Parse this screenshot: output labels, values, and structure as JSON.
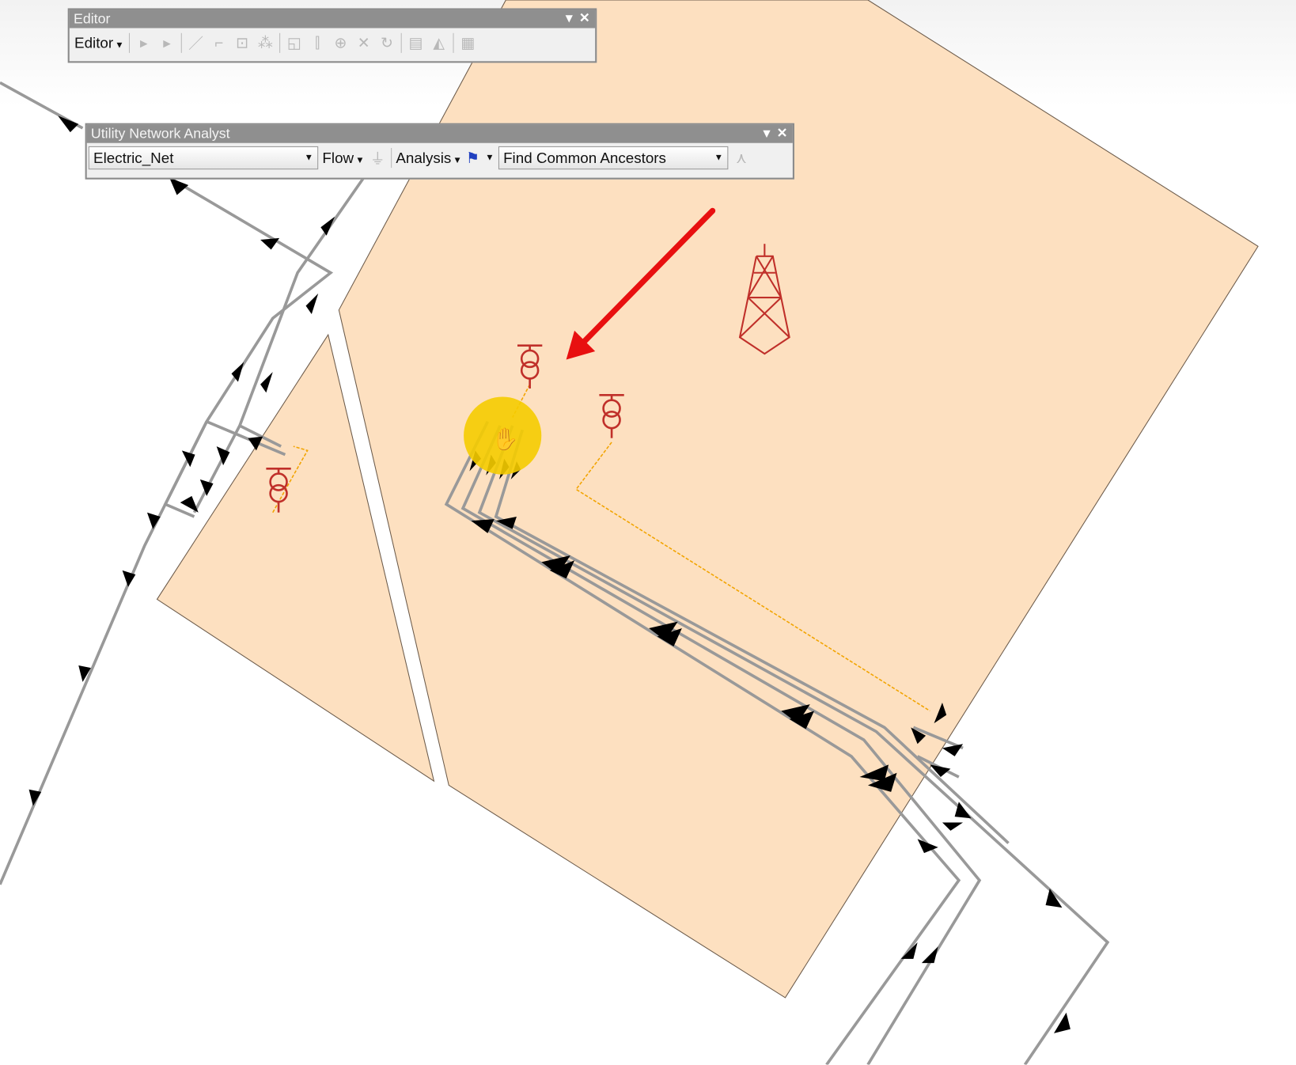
{
  "editor_toolbar": {
    "title": "Editor",
    "menu_label": "Editor",
    "tools": [
      "edit-tool-icon",
      "edit-annotation-icon",
      "straight-segment-icon",
      "trace-icon",
      "construct-points-icon",
      "midpoint-icon",
      "reshape-icon",
      "split-icon",
      "cut-polygons-icon",
      "intersect-icon",
      "rotate-icon",
      "attributes-icon",
      "sketch-properties-icon",
      "create-features-icon"
    ]
  },
  "una_toolbar": {
    "title": "Utility Network Analyst",
    "network_value": "Electric_Net",
    "flow_label": "Flow",
    "analysis_label": "Analysis",
    "trace_task_value": "Find Common Ancestors"
  },
  "colors": {
    "parcel": "#fde0c0",
    "line": "#999999",
    "service": "#f2a400",
    "symbol": "#c0302a",
    "highlight": "#f5cc00",
    "annotation_arrow": "#e81010"
  }
}
